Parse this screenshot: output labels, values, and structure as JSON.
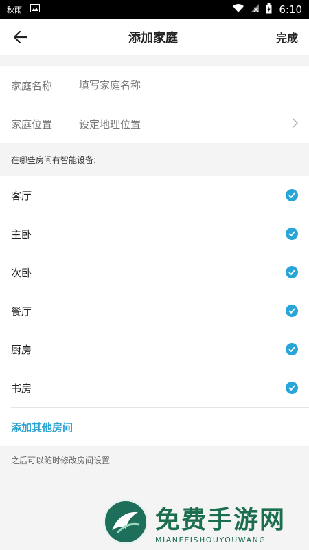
{
  "status": {
    "left_text": "秋雨",
    "time": "6:10"
  },
  "header": {
    "title": "添加家庭",
    "done_label": "完成"
  },
  "form": {
    "name_label": "家庭名称",
    "name_placeholder": "填写家庭名称",
    "location_label": "家庭位置",
    "location_value": "设定地理位置"
  },
  "rooms_section_note": "在哪些房间有智能设备:",
  "rooms": [
    {
      "label": "客厅",
      "checked": true
    },
    {
      "label": "主卧",
      "checked": true
    },
    {
      "label": "次卧",
      "checked": true
    },
    {
      "label": "餐厅",
      "checked": true
    },
    {
      "label": "厨房",
      "checked": true
    },
    {
      "label": "书房",
      "checked": true
    }
  ],
  "add_room_label": "添加其他房间",
  "footer_note": "之后可以随时修改房间设置",
  "watermark": {
    "main": "免费手游网",
    "sub": "MIANFEISHOUYOUWANG"
  },
  "colors": {
    "accent": "#29a5d7",
    "background": "#f4f4f4"
  }
}
